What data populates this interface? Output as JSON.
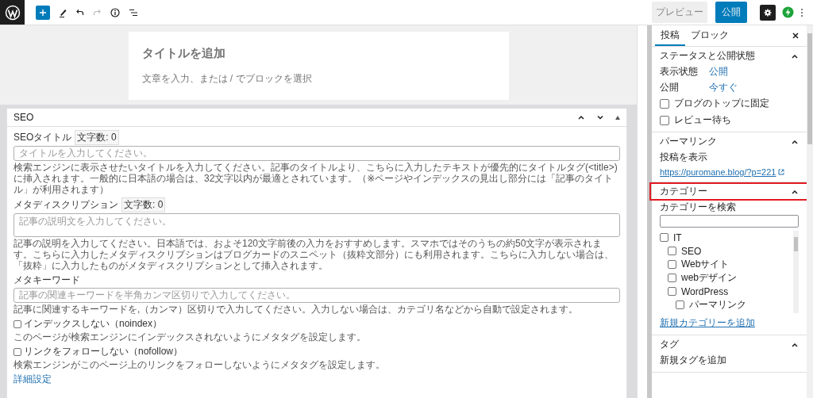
{
  "toolbar": {
    "preview": "プレビュー",
    "publish": "公開"
  },
  "editor": {
    "title_placeholder": "タイトルを追加",
    "body_placeholder": "文章を入力、または / でブロックを選択"
  },
  "seo_box": {
    "title": "SEO",
    "expanded": true,
    "fields": [
      {
        "kind": "input",
        "label": "SEOタイトル",
        "count": "文字数: 0",
        "placeholder": "タイトルを入力してください。",
        "help": "検索エンジンに表示させたいタイトルを入力してください。記事のタイトルより、こちらに入力したテキストが優先的にタイトルタグ(<title>)に挿入されます。一般的に日本語の場合は、32文字以内が最適とされています。（※ページやインデックスの見出し部分には「記事のタイトル」が利用されます）"
      },
      {
        "kind": "textarea",
        "label": "メタディスクリプション",
        "count": "文字数: 0",
        "placeholder": "記事の説明文を入力してください。",
        "help": "記事の説明を入力してください。日本語では、およそ120文字前後の入力をおすすめします。スマホではそのうちの約50文字が表示されます。こちらに入力したメタディスクリプションはブログカードのスニペット（抜粋文部分）にも利用されます。こちらに入力しない場合は、「抜粋」に入力したものがメタディスクリプションとして挿入されます。"
      },
      {
        "kind": "input",
        "label": "メタキーワード",
        "placeholder": "記事の関連キーワードを半角カンマ区切りで入力してください。",
        "help": "記事に関連するキーワードを,（カンマ）区切りで入力してください。入力しない場合は、カテゴリ名などから自動で設定されます。"
      }
    ],
    "options": [
      {
        "label": "インデックスしない（noindex）",
        "checked": false,
        "help": "このページが検索エンジンにインデックスされないようにメタタグを設定します。"
      },
      {
        "label": "リンクをフォローしない（nofollow）",
        "checked": false,
        "help": "検索エンジンがこのページ上のリンクをフォローしないようにメタタグを設定します。"
      }
    ],
    "link": "詳細設定"
  },
  "sidebar": {
    "tabs": [
      {
        "label": "投稿",
        "selected": true
      },
      {
        "label": "ブロック",
        "selected": false
      }
    ],
    "sections": [
      {
        "kind": "status",
        "title": "ステータスと公開状態",
        "expanded": true,
        "highlighted": false,
        "rows": [
          {
            "label": "表示状態",
            "value": "公開"
          },
          {
            "label": "公開",
            "value": "今すぐ"
          }
        ],
        "options": [
          {
            "label": "ブログのトップに固定",
            "checked": false
          },
          {
            "label": "レビュー待ち",
            "checked": false
          }
        ]
      },
      {
        "kind": "permalink",
        "title": "パーマリンク",
        "expanded": true,
        "highlighted": false,
        "label": "投稿を表示",
        "url": "https://puromane.blog/?p=221"
      },
      {
        "kind": "category",
        "title": "カテゴリー",
        "expanded": true,
        "highlighted": true,
        "search_label": "カテゴリーを検索",
        "items": [
          {
            "label": "IT",
            "checked": false,
            "children": [
              {
                "label": "SEO",
                "checked": false
              },
              {
                "label": "Webサイト",
                "checked": false
              },
              {
                "label": "webデザイン",
                "checked": false
              },
              {
                "label": "WordPress",
                "checked": false,
                "children": [
                  {
                    "label": "パーマリンク",
                    "checked": false
                  }
                ]
              }
            ]
          }
        ],
        "add_link": "新規カテゴリーを追加"
      },
      {
        "kind": "tags",
        "title": "タグ",
        "expanded": true,
        "highlighted": false,
        "label": "新規タグを追加"
      }
    ]
  }
}
